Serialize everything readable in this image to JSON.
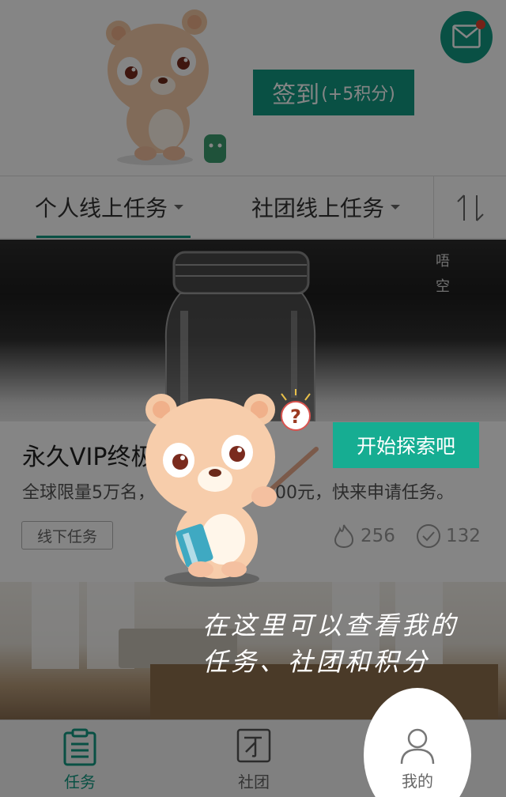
{
  "header": {
    "signin_label": "签到",
    "signin_bonus": "(+5积分)",
    "mail_icon": "envelope-icon",
    "mail_badge": true
  },
  "tabs": {
    "items": [
      {
        "label": "个人线上任务",
        "active": true
      },
      {
        "label": "社团线上任务",
        "active": false
      }
    ],
    "sort_icon": "sort-arrows-icon"
  },
  "tasks": [
    {
      "image_caption": [
        "唔",
        "空"
      ],
      "title": "永久VIP终极",
      "desc_left": "全球限量5万名，",
      "desc_right": "00元，快来申请任务。",
      "tag": "线下任务",
      "hot_count": "256",
      "done_count": "132"
    }
  ],
  "guide": {
    "button_label": "开始探索吧",
    "hint_line1": "在这里可以查看我的",
    "hint_line2": "任务、社团和积分"
  },
  "bottom_nav": [
    {
      "label": "任务",
      "icon": "clipboard-icon",
      "active": true
    },
    {
      "label": "社团",
      "icon": "club-icon",
      "active": false
    },
    {
      "label": "我的",
      "icon": "user-icon",
      "active": false
    }
  ],
  "colors": {
    "accent": "#129982",
    "accent_light": "#16ad92",
    "badge": "#e0432f"
  }
}
